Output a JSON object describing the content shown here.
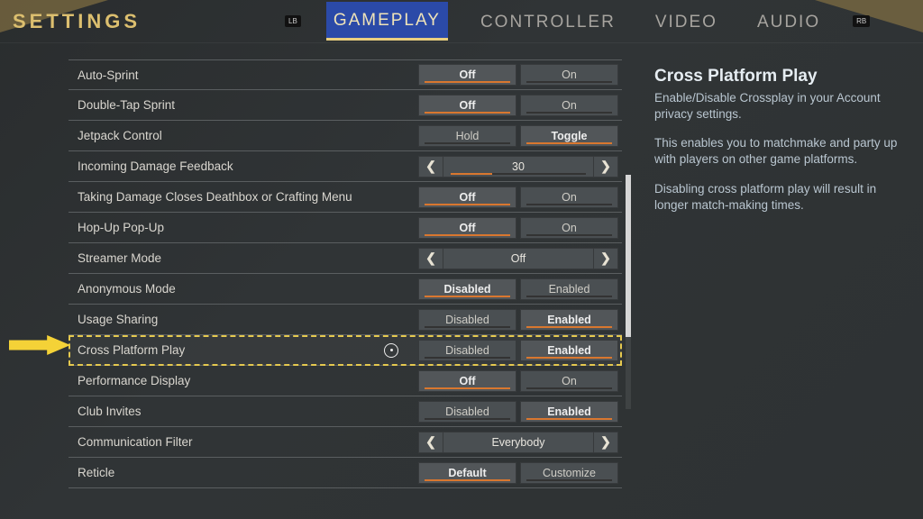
{
  "header": {
    "title": "SETTINGS",
    "bumper_left": "LB",
    "bumper_right": "RB",
    "tabs": [
      {
        "label": "GAMEPLAY",
        "active": true
      },
      {
        "label": "CONTROLLER",
        "active": false
      },
      {
        "label": "VIDEO",
        "active": false
      },
      {
        "label": "AUDIO",
        "active": false
      }
    ]
  },
  "rows": [
    {
      "label": "Auto-Sprint",
      "type": "toggle2",
      "options": [
        "Off",
        "On"
      ],
      "selected": 0
    },
    {
      "label": "Double-Tap Sprint",
      "type": "toggle2",
      "options": [
        "Off",
        "On"
      ],
      "selected": 0
    },
    {
      "label": "Jetpack Control",
      "type": "toggle2",
      "options": [
        "Hold",
        "Toggle"
      ],
      "selected": 1
    },
    {
      "label": "Incoming Damage Feedback",
      "type": "stepper",
      "value": "30",
      "numeric": true
    },
    {
      "label": "Taking Damage Closes Deathbox or Crafting Menu",
      "type": "toggle2",
      "options": [
        "Off",
        "On"
      ],
      "selected": 0
    },
    {
      "label": "Hop-Up Pop-Up",
      "type": "toggle2",
      "options": [
        "Off",
        "On"
      ],
      "selected": 0
    },
    {
      "label": "Streamer Mode",
      "type": "stepper",
      "value": "Off",
      "numeric": false
    },
    {
      "label": "Anonymous Mode",
      "type": "toggle2",
      "options": [
        "Disabled",
        "Enabled"
      ],
      "selected": 0
    },
    {
      "label": "Usage Sharing",
      "type": "toggle2",
      "options": [
        "Disabled",
        "Enabled"
      ],
      "selected": 1
    },
    {
      "label": "Cross Platform Play",
      "type": "toggle2",
      "options": [
        "Disabled",
        "Enabled"
      ],
      "selected": 1,
      "highlighted": true
    },
    {
      "label": "Performance Display",
      "type": "toggle2",
      "options": [
        "Off",
        "On"
      ],
      "selected": 0
    },
    {
      "label": "Club Invites",
      "type": "toggle2",
      "options": [
        "Disabled",
        "Enabled"
      ],
      "selected": 1
    },
    {
      "label": "Communication Filter",
      "type": "stepper",
      "value": "Everybody",
      "numeric": false
    },
    {
      "label": "Reticle",
      "type": "toggle2",
      "options": [
        "Default",
        "Customize"
      ],
      "selected": 0
    }
  ],
  "detail": {
    "title": "Cross Platform Play",
    "p1": "Enable/Disable Crossplay in your Account privacy settings.",
    "p2": "This enables you to matchmake and party up with players on other game platforms.",
    "p3": "Disabling cross platform play will result in longer match-making times."
  },
  "glyphs": {
    "left": "❮",
    "right": "❯"
  }
}
